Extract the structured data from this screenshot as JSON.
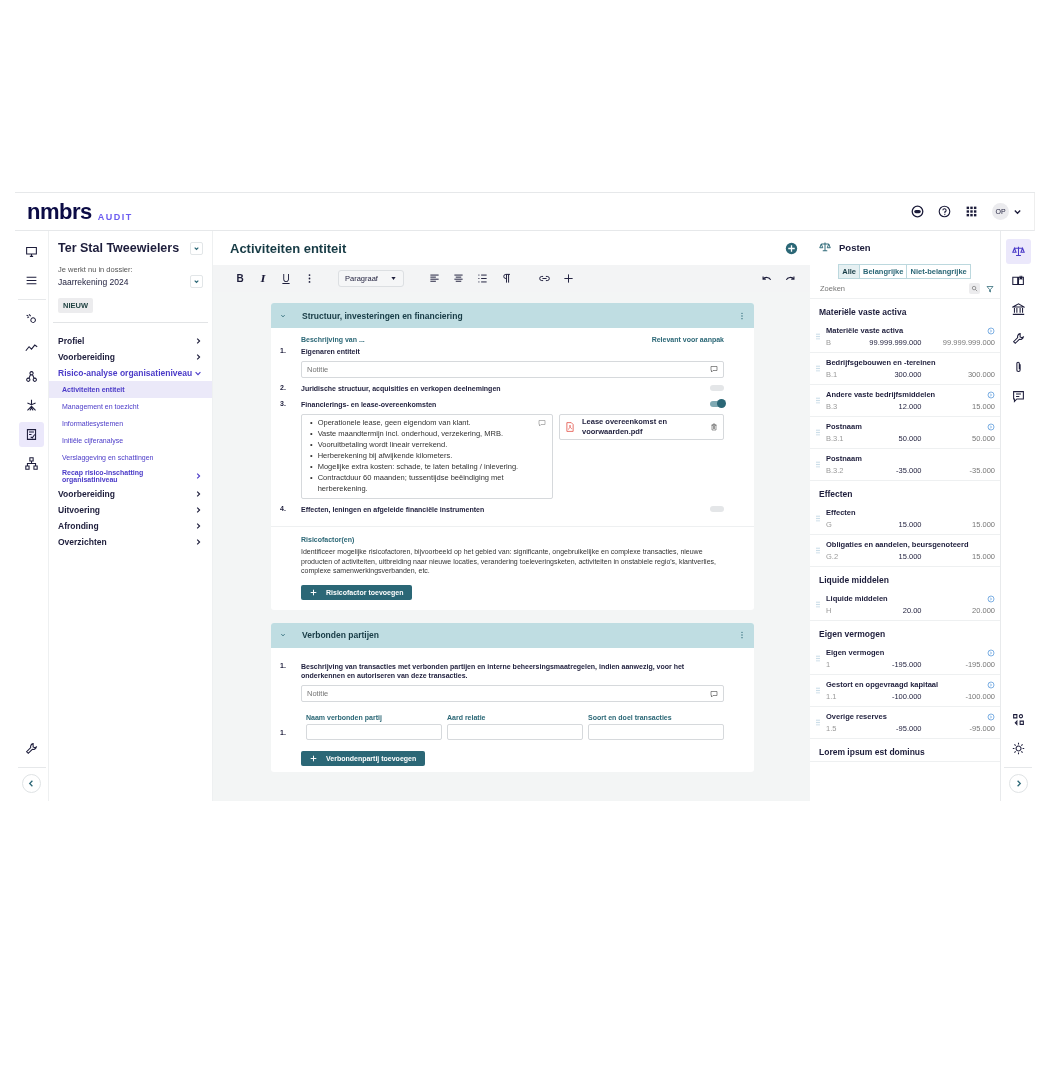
{
  "header": {
    "logo": "nmbrs",
    "logo_suffix": "AUDIT",
    "avatar": "OP"
  },
  "left_rail": {
    "items": [
      {
        "kind": "monitor",
        "selected": false
      },
      {
        "kind": "menu",
        "selected": false
      },
      {
        "kind": "pin",
        "selected": false
      },
      {
        "kind": "trend",
        "selected": false
      },
      {
        "kind": "nodes",
        "selected": false
      },
      {
        "kind": "spark",
        "selected": false
      },
      {
        "kind": "checklist",
        "selected": true
      },
      {
        "kind": "org",
        "selected": false
      }
    ],
    "bottom": [
      {
        "kind": "wrench",
        "selected": false
      }
    ]
  },
  "sidebar": {
    "client": "Ter Stal Tweewielers",
    "dossier_label": "Je werkt nu in dossier:",
    "dossier": "Jaarrekening 2024",
    "badge": "NIEUW",
    "nav": [
      {
        "label": "Profiel",
        "expanded": false
      },
      {
        "label": "Voorbereiding",
        "expanded": false
      },
      {
        "label": "Risico-analyse organisatieniveau",
        "expanded": true,
        "children": [
          {
            "label": "Activiteiten entiteit",
            "selected": true,
            "expandable": false
          },
          {
            "label": "Management en toezicht",
            "selected": false,
            "expandable": false
          },
          {
            "label": "Informatiesystemen",
            "selected": false,
            "expandable": false
          },
          {
            "label": "Initiële cijferanalyse",
            "selected": false,
            "expandable": false
          },
          {
            "label": "Verslaggeving en schattingen",
            "selected": false,
            "expandable": false
          },
          {
            "label": "Recap risico-inschatting organisatiniveau",
            "selected": false,
            "expandable": true
          }
        ]
      },
      {
        "label": "Voorbereiding",
        "expanded": false
      },
      {
        "label": "Uitvoering",
        "expanded": false
      },
      {
        "label": "Afronding",
        "expanded": false
      },
      {
        "label": "Overzichten",
        "expanded": false
      }
    ]
  },
  "main": {
    "title": "Activiteiten entiteit",
    "toolbar": {
      "format_buttons": [
        "B",
        "I",
        "U"
      ],
      "paragraph": "Paragraaf"
    },
    "section_1": {
      "title": "Structuur, investeringen en financiering",
      "expanded": true,
      "column_left": "Beschrijving van ...",
      "column_right": "Relevant voor aanpak",
      "items": [
        {
          "number": "1.",
          "label": "Eigenaren entiteit",
          "note_placeholder": "Notitie"
        },
        {
          "number": "2.",
          "label": "Juridische structuur, acquisities en verkopen deelnemingen",
          "relevant": false
        },
        {
          "number": "3.",
          "label": "Financierings- en lease-overeenkomsten",
          "relevant": true,
          "note_bullet": "•",
          "note_lines": [
            "Operationele lease, geen eigendom van klant.",
            "Vaste maandtermijn incl. onderhoud, verzekering, MRB.",
            "Vooruitbetaling wordt lineair verrekend.",
            "Herberekening bij afwijkende kilometers.",
            "Mogelijke extra kosten: schade, te laten betaling / inlevering.",
            "Contractduur 60 maanden; tussentijdse beëindiging met herberekening."
          ],
          "attachment": "Lease overeenkomst en voorwaarden.pdf"
        },
        {
          "number": "4.",
          "label": "Effecten, leningen en afgeleide financiële instrumenten",
          "relevant": false
        }
      ],
      "risk_heading": "Risicofactor(en)",
      "risk_text": "Identificeer mogelijke risicofactoren, bijvoorbeeld op het gebied van: significante, ongebruikelijke en complexe transacties, nieuwe producten of activiteiten, uitbreiding naar nieuwe locaties, verandering toeleveringsketen, activiteiten in onstabiele regio's, klantverlies, complexe samenwerkingsverbanden, etc.",
      "risk_button": "Risicofactor toevoegen"
    },
    "section_2": {
      "title": "Verbonden partijen",
      "expanded": true,
      "number": "1.",
      "question": "Beschrijving van transacties met verbonden partijen en interne beheersingsmaatregelen, indien aanwezig, voor het onderkennen en autoriseren van deze transacties.",
      "note_placeholder": "Notitie",
      "columns": [
        "Naam verbonden partij",
        "Aard relatie",
        "Soort en doel transacties"
      ],
      "row_number": "1.",
      "button": "Verbondenpartij toevoegen"
    }
  },
  "posten": {
    "title": "Posten",
    "filters": [
      {
        "label": "Alle",
        "selected": true
      },
      {
        "label": "Belangrijke",
        "selected": false
      },
      {
        "label": "Niet-belangrijke",
        "selected": false
      }
    ],
    "search_placeholder": "Zoeken",
    "groups": [
      {
        "title": "Materiële vaste activa",
        "items": [
          {
            "name": "Materiële vaste activa",
            "code": "B",
            "value_1": "99.999.999.000",
            "value_2": "99.999.999.000",
            "flagged": true
          },
          {
            "name": "Bedrijfsgebouwen en -tereinen",
            "code": "B.1",
            "value_1": "300.000",
            "value_2": "300.000",
            "flagged": false
          },
          {
            "name": "Andere vaste bedrijfsmiddelen",
            "code": "B.3",
            "value_1": "12.000",
            "value_2": "15.000",
            "flagged": true
          },
          {
            "name": "Postnaam",
            "code": "B.3.1",
            "value_1": "50.000",
            "value_2": "50.000",
            "flagged": true
          },
          {
            "name": "Postnaam",
            "code": "B.3.2",
            "value_1": "-35.000",
            "value_2": "-35.000",
            "flagged": false
          }
        ]
      },
      {
        "title": "Effecten",
        "items": [
          {
            "name": "Effecten",
            "code": "G",
            "value_1": "15.000",
            "value_2": "15.000",
            "flagged": false
          },
          {
            "name": "Obligaties en aandelen, beursgenoteerd",
            "code": "G.2",
            "value_1": "15.000",
            "value_2": "15.000",
            "flagged": false
          }
        ]
      },
      {
        "title": "Liquide middelen",
        "items": [
          {
            "name": "Liquide middelen",
            "code": "H",
            "value_1": "20.00",
            "value_2": "20.000",
            "flagged": true
          }
        ]
      },
      {
        "title": "Eigen vermogen",
        "items": [
          {
            "name": "Eigen vermogen",
            "code": "1",
            "value_1": "-195.000",
            "value_2": "-195.000",
            "flagged": true
          },
          {
            "name": "Gestort en opgevraagd kapitaal",
            "code": "1.1",
            "value_1": "-100.000",
            "value_2": "-100.000",
            "flagged": true
          },
          {
            "name": "Overige reserves",
            "code": "1.5",
            "value_1": "-95.000",
            "value_2": "-95.000",
            "flagged": true
          }
        ]
      },
      {
        "title": "Lorem ipsum est dominus"
      }
    ]
  },
  "right_rail": {
    "items": [
      {
        "kind": "scale",
        "selected": true
      },
      {
        "kind": "book",
        "selected": false
      },
      {
        "kind": "bank",
        "selected": false
      },
      {
        "kind": "wrench",
        "selected": false
      },
      {
        "kind": "clip",
        "selected": false
      },
      {
        "kind": "comment",
        "selected": false
      }
    ],
    "bottom": [
      {
        "kind": "compare",
        "selected": false
      },
      {
        "kind": "gear",
        "selected": false
      }
    ]
  }
}
